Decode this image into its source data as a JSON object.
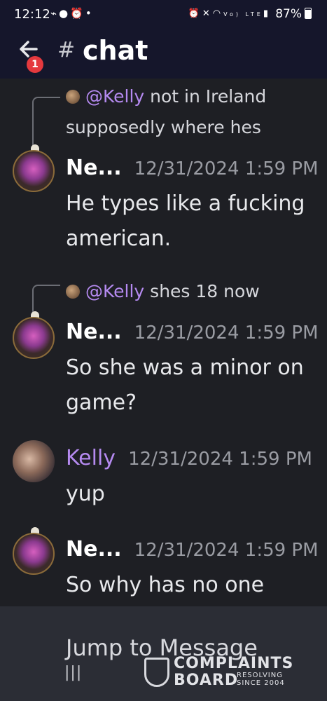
{
  "status_bar": {
    "time": "12:12",
    "left_icons": [
      "gamepad-icon",
      "facebook-icon",
      "alarm-icon",
      "dot-icon"
    ],
    "right_icons": [
      "alarm-icon",
      "mute-icon",
      "wifi-icon",
      "volte-icon",
      "signal-icon"
    ],
    "volte_label": "Vo) LTE",
    "battery": "87%"
  },
  "header": {
    "back_badge": "1",
    "hash": "#",
    "channel": "chat"
  },
  "messages": [
    {
      "reply_to": {
        "mention": "@Kelly",
        "text": " not in Ireland supposedly where hes"
      },
      "author": "Ne...",
      "timestamp": "12/31/2024 1:59 PM",
      "text": "He types like a fucking american."
    },
    {
      "reply_to": {
        "mention": "@Kelly",
        "text": " shes 18 now"
      },
      "author": "Ne...",
      "timestamp": "12/31/2024 1:59 PM",
      "text": "So she was a minor on game?"
    },
    {
      "author": "Kelly",
      "timestamp": "12/31/2024 1:59 PM",
      "text": "yup"
    },
    {
      "author": "Ne...",
      "timestamp": "12/31/2024 1:59 PM",
      "text": "So why has no one"
    }
  ],
  "jump_bar": {
    "label": "Jump to Message"
  },
  "nav": {
    "recents": "|||"
  },
  "watermark": {
    "line1": "COMPLAINTS",
    "line2": "BOARD",
    "tag1": "RESOLVING",
    "tag2": "SINCE 2004"
  },
  "colors": {
    "mention": "#b58af0",
    "badge": "#e5393e",
    "header_bg": "#15162b",
    "bg": "#1e1f24"
  }
}
